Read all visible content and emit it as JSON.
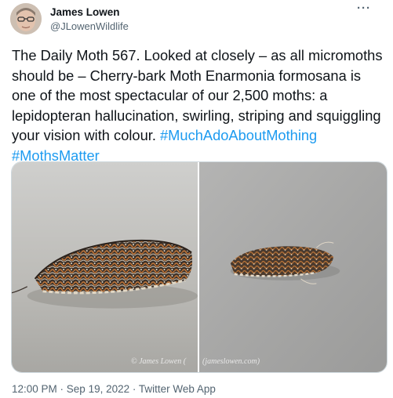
{
  "author": {
    "name": "James Lowen",
    "handle": "@JLowenWildlife"
  },
  "more_label": "···",
  "tweet": {
    "text": "The Daily Moth 567. Looked at closely – as all micromoths should be – Cherry-bark Moth Enarmonia formosana is one of the most spectacular of our 2,500 moths: a lepidopteran hallucination, swirling, striping and squiggling your vision with colour.",
    "hashtags": [
      "#MuchAdoAboutMothing",
      "#MothsMatter"
    ]
  },
  "media": {
    "watermark_left": "© James Lowen (",
    "watermark_right": "(jameslowen.com)"
  },
  "meta": {
    "time": "12:00 PM",
    "separator": " · ",
    "date": "Sep 19, 2022",
    "source": "Twitter Web App"
  }
}
